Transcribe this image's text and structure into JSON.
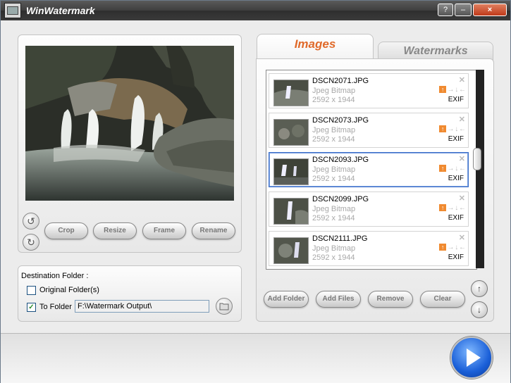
{
  "window": {
    "title": "WinWatermark",
    "controls": {
      "help": "?",
      "minimize": "–",
      "close": "×"
    }
  },
  "preview_panel": {
    "buttons": {
      "crop": "Crop",
      "resize": "Resize",
      "frame": "Frame",
      "rename": "Rename"
    },
    "rotate_left_icon": "rotate-ccw-icon",
    "rotate_right_icon": "rotate-cw-icon"
  },
  "destination": {
    "title": "Destination Folder :",
    "original_folder": {
      "label": "Original Folder(s)",
      "checked": false
    },
    "to_folder": {
      "label": "To Folder",
      "checked": true,
      "check_glyph": "✓",
      "path": "F:\\Watermark Output\\"
    }
  },
  "tabs": [
    {
      "label": "Images",
      "active": true
    },
    {
      "label": "Watermarks",
      "active": false
    }
  ],
  "files": [
    {
      "name": "DSCN2071.JPG",
      "type": "Jpeg Bitmap",
      "size": "2592 x 1944",
      "exif": "EXIF",
      "selected": false
    },
    {
      "name": "DSCN2073.JPG",
      "type": "Jpeg Bitmap",
      "size": "2592 x 1944",
      "exif": "EXIF",
      "selected": false
    },
    {
      "name": "DSCN2093.JPG",
      "type": "Jpeg Bitmap",
      "size": "2592 x 1944",
      "exif": "EXIF",
      "selected": true
    },
    {
      "name": "DSCN2099.JPG",
      "type": "Jpeg Bitmap",
      "size": "2592 x 1944",
      "exif": "EXIF",
      "selected": false
    },
    {
      "name": "DSCN2111.JPG",
      "type": "Jpeg Bitmap",
      "size": "2592 x 1944",
      "exif": "EXIF",
      "selected": false
    }
  ],
  "item_glyphs": {
    "close": "✕",
    "up": "↑",
    "right": "→",
    "down": "↓",
    "left": "←"
  },
  "list_buttons": {
    "add_folder": "Add Folder",
    "add_files": "Add Files",
    "remove": "Remove",
    "clear": "Clear"
  },
  "move_up_glyph": "↑",
  "move_down_glyph": "↓",
  "colors": {
    "accent_orange": "#e06a2a",
    "play_blue": "#1a5fd8",
    "selection_blue": "#3b6ec8"
  }
}
